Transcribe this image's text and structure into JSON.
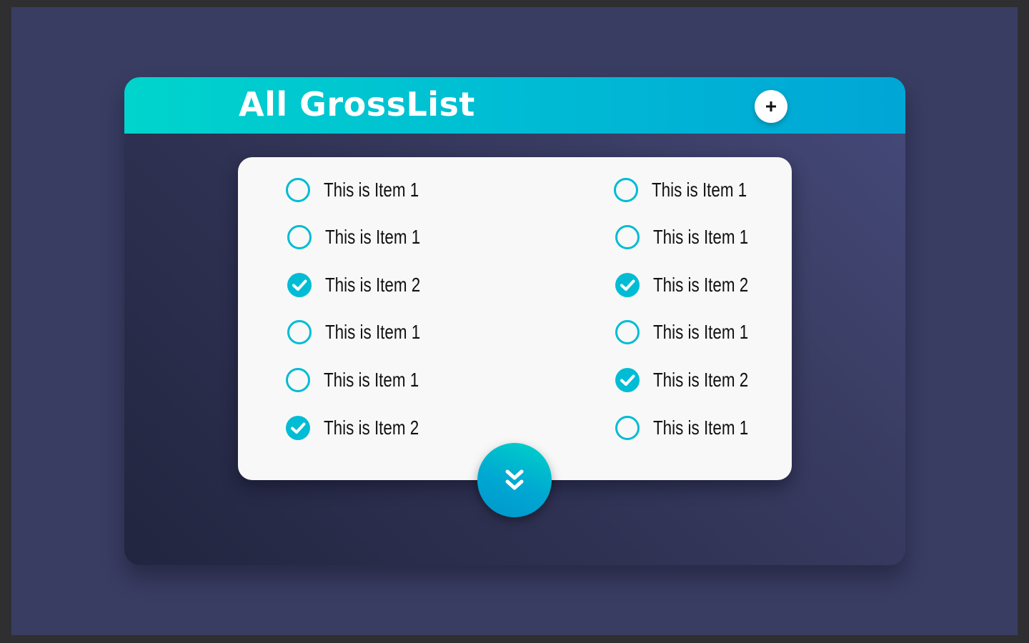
{
  "header": {
    "title": "All GrossList",
    "add_button_icon": "plus-icon"
  },
  "colors": {
    "accent": "#00bcd4",
    "header_gradient_start": "#00d4cc",
    "header_gradient_end": "#00a6d6",
    "background": "#393d62",
    "panel": "#f8f8f8"
  },
  "list": {
    "left_column": [
      {
        "label": "This is Item 1",
        "checked": false
      },
      {
        "label": "This is Item 1",
        "checked": false
      },
      {
        "label": "This is Item 2",
        "checked": true
      },
      {
        "label": "This is Item 1",
        "checked": false
      },
      {
        "label": "This is Item 1",
        "checked": false
      },
      {
        "label": "This is Item 2",
        "checked": true
      }
    ],
    "right_column": [
      {
        "label": "This is Item 1",
        "checked": false
      },
      {
        "label": "This is Item 1",
        "checked": false
      },
      {
        "label": "This is Item 2",
        "checked": true
      },
      {
        "label": "This is Item 1",
        "checked": false
      },
      {
        "label": "This is Item 2",
        "checked": true
      },
      {
        "label": "This is Item 1",
        "checked": false
      }
    ]
  },
  "footer": {
    "expand_button_icon": "chevrons-down-icon"
  }
}
